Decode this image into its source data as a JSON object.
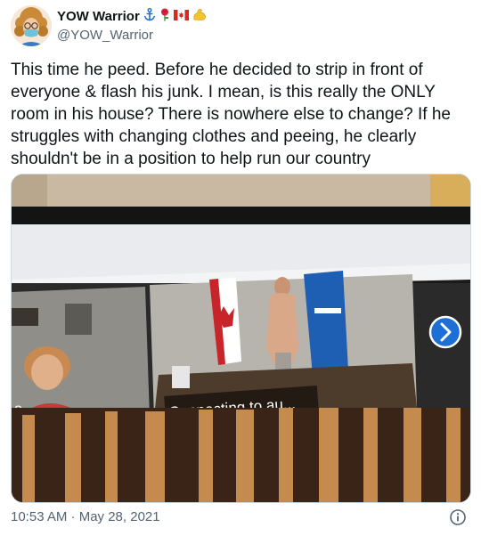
{
  "author": {
    "display_name": "YOW Warrior",
    "handle": "@YOW_Warrior",
    "name_emojis": [
      "anchor-icon",
      "rose-icon",
      "canada-flag-icon",
      "flexed-biceps-icon"
    ]
  },
  "tweet": {
    "text": "This time he peed. Before he decided to strip in front of everyone & flash his junk. I mean, is this really the ONLY room in his house? There is nowhere else to change? If he struggles with changing clothes and peeing, he clearly shouldn't be in a position to help run our country"
  },
  "media": {
    "overlay_text": "Connecting to au...",
    "overlay_ellipsis": "...",
    "left_tile_label": "o",
    "next_icon": "chevron-right-icon"
  },
  "meta": {
    "timestamp": "10:53 AM · May 28, 2021",
    "info_icon": "info-icon"
  },
  "colors": {
    "text_primary": "#0f1419",
    "text_secondary": "#536471",
    "zoom_blue": "#1d6fd6"
  }
}
